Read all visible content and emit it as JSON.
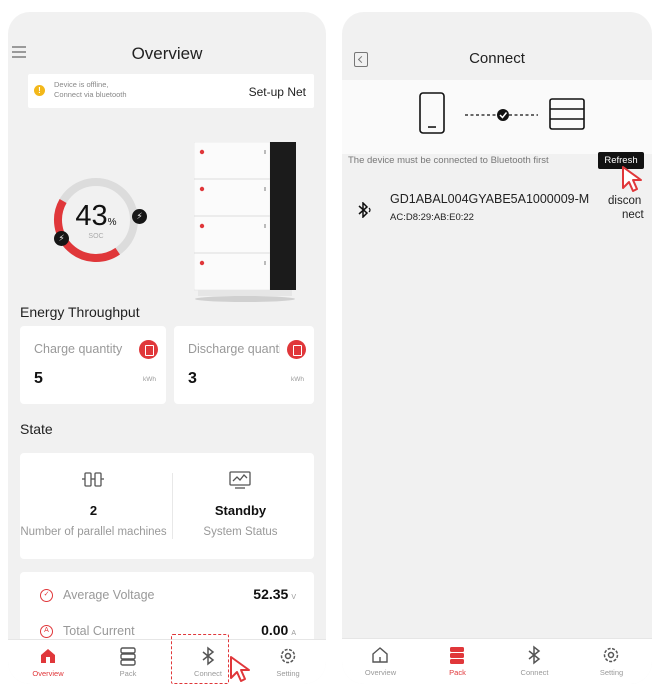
{
  "left": {
    "header": {
      "title": "Overview",
      "menu_icon": "hamburger-menu-icon"
    },
    "offline_banner": {
      "line1": "Device is offline,",
      "line2": "Connect via bluetooth",
      "action": "Set-up Net",
      "icon": "warning-icon"
    },
    "soc": {
      "value": "43",
      "unit": "%",
      "label": "SOC",
      "fraction": 0.43
    },
    "energy": {
      "title": "Energy Throughput",
      "charge": {
        "label": "Charge quantity",
        "value": "5",
        "unit": "kWh"
      },
      "discharge": {
        "label": "Discharge quantity",
        "value": "3",
        "unit": "kWh"
      }
    },
    "state": {
      "title": "State",
      "parallel": {
        "value": "2",
        "label": "Number of parallel machines"
      },
      "status": {
        "value": "Standby",
        "label": "System Status"
      }
    },
    "metrics": [
      {
        "label": "Average Voltage",
        "value": "52.35",
        "unit": "V"
      },
      {
        "label": "Total Current",
        "value": "0.00",
        "unit": "A"
      }
    ],
    "tabs": [
      {
        "label": "Overview",
        "icon": "home-icon",
        "active": true
      },
      {
        "label": "Pack",
        "icon": "battery-pack-icon",
        "active": false
      },
      {
        "label": "Connect",
        "icon": "bluetooth-icon",
        "active": false
      },
      {
        "label": "Setting",
        "icon": "gear-icon",
        "active": false
      }
    ]
  },
  "right": {
    "header": {
      "title": "Connect",
      "back_icon": "back-icon"
    },
    "note": "The device must be connected to Bluetooth first",
    "refresh_label": "Refresh",
    "device": {
      "name": "GD1ABAL004GYABE5A1000009-M",
      "mac": "AC:D8:29:AB:E0:22",
      "action_line1": "discon",
      "action_line2": "nect"
    },
    "tabs": [
      {
        "label": "Overview",
        "icon": "home-icon",
        "active": false
      },
      {
        "label": "Pack",
        "icon": "battery-pack-icon",
        "active": true
      },
      {
        "label": "Connect",
        "icon": "bluetooth-icon",
        "active": false
      },
      {
        "label": "Setting",
        "icon": "gear-icon",
        "active": false
      }
    ]
  },
  "colors": {
    "accent": "#e0373a",
    "background": "#f1f1f1",
    "card": "#ffffff"
  }
}
